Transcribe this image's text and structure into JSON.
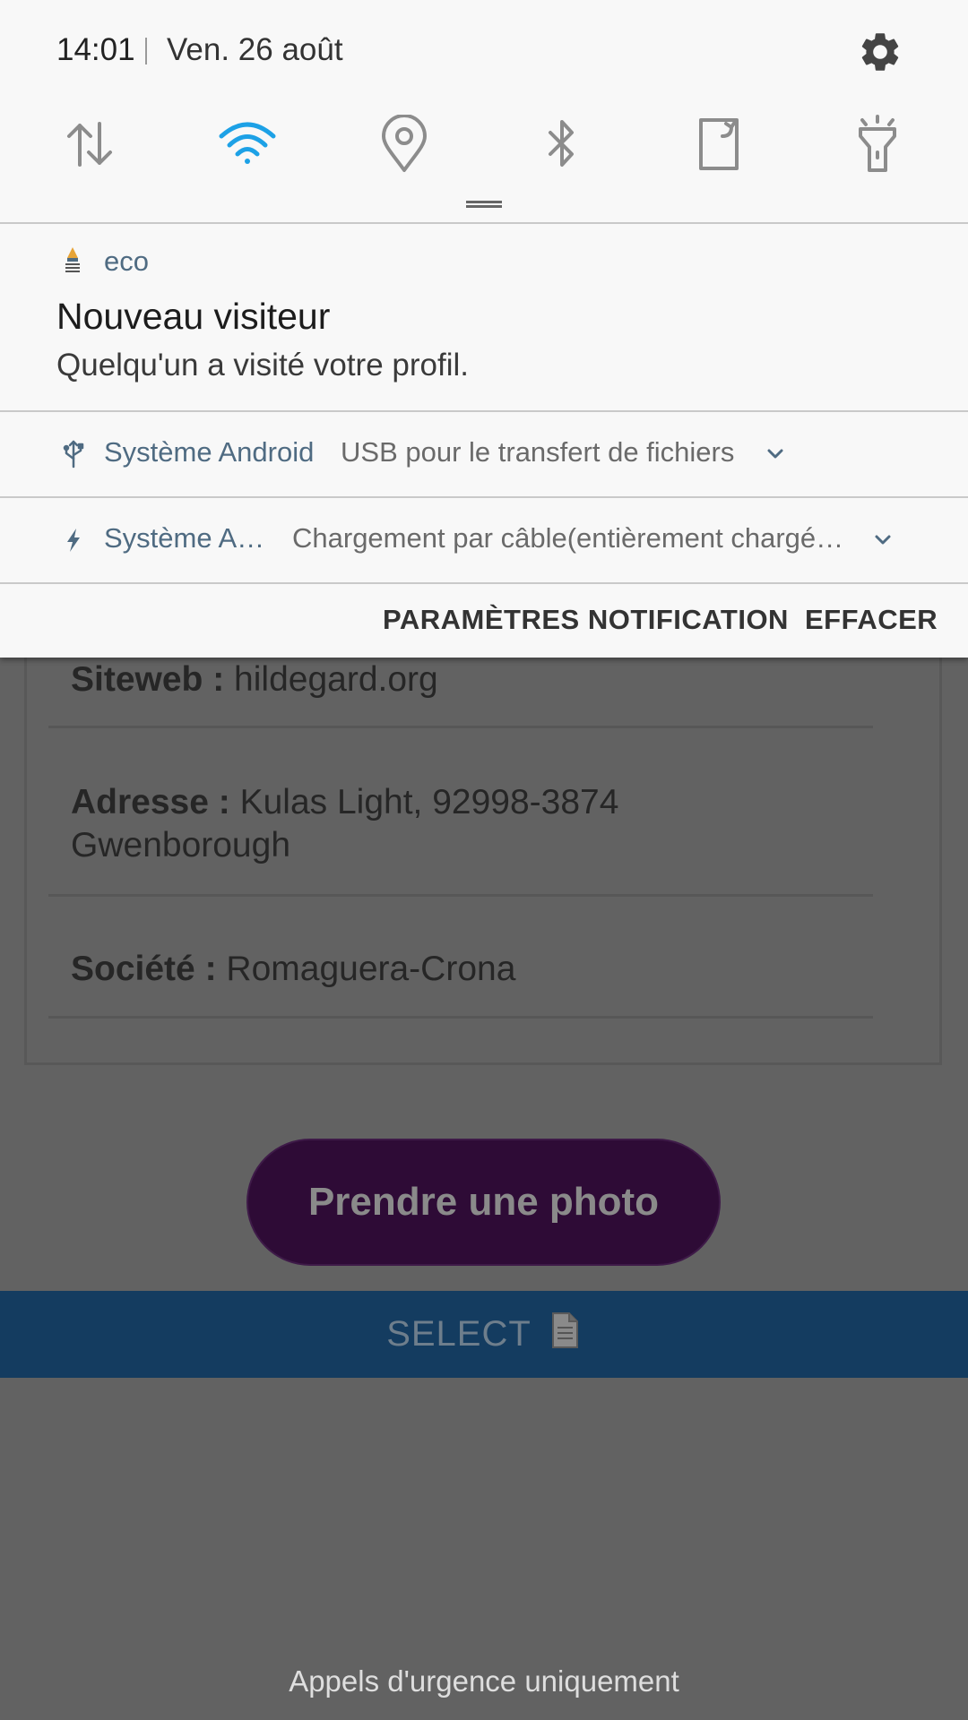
{
  "status_bar": {
    "time": "14:01",
    "date": "Ven. 26 août"
  },
  "quick_settings": {
    "icons": [
      "data-transfer-icon",
      "wifi-icon",
      "location-icon",
      "bluetooth-icon",
      "screen-rotation-icon",
      "flashlight-icon"
    ],
    "active_color": "#1da1e6",
    "inactive_color": "#8c8c8c"
  },
  "notifications": {
    "eco": {
      "app_name": "eco",
      "title": "Nouveau visiteur",
      "body": "Quelqu'un a visité votre profil."
    },
    "usb": {
      "app_name": "Système Android",
      "text": "USB pour le transfert de fichiers"
    },
    "charging": {
      "app_name": "Système A…",
      "text": "Chargement par câble(entièrement chargé…"
    },
    "actions": {
      "settings_label": "PARAMÈTRES NOTIFICATION",
      "clear_label": "EFFACER"
    }
  },
  "profile": {
    "website_label": "Siteweb :",
    "website_value": "hildegard.org",
    "address_label": "Adresse :",
    "address_line1": "Kulas Light, 92998-3874",
    "address_line2": "Gwenborough",
    "company_label": "Société :",
    "company_value": "Romaguera-Crona"
  },
  "buttons": {
    "take_photo": "Prendre une photo",
    "select": "SELECT"
  },
  "lockscreen": {
    "emergency_text": "Appels d'urgence uniquement"
  },
  "colors": {
    "accent_blue": "#1da1e6",
    "photo_button": "#2e0b36",
    "select_bar": "#143c60",
    "app_name_color": "#4f6b82"
  }
}
